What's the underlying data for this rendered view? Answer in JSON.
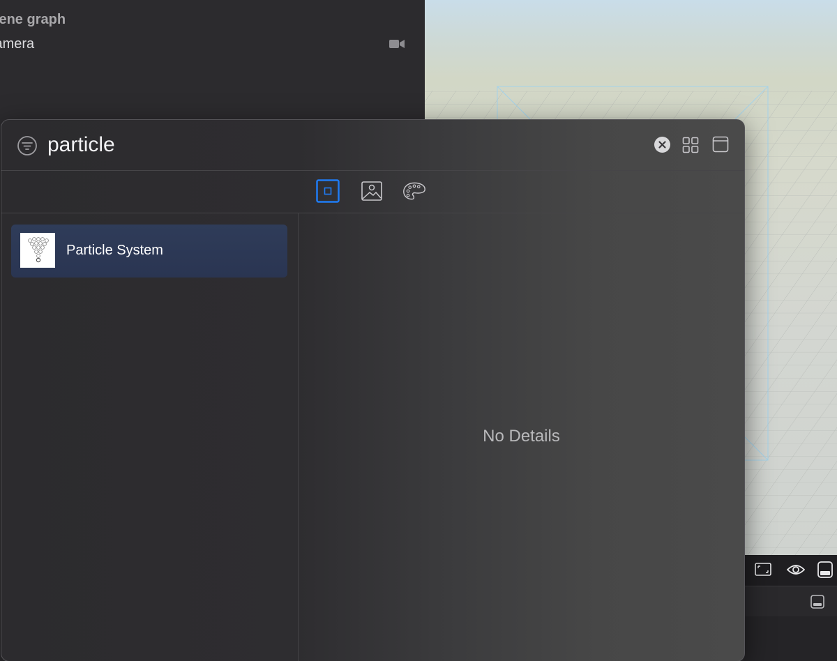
{
  "scene_graph": {
    "title": "Scene graph",
    "items": [
      {
        "label": "Camera",
        "icon": "camera-icon"
      }
    ]
  },
  "library": {
    "search": {
      "value": "particle",
      "filter_icon": "filter-icon",
      "clear_icon": "clear-icon"
    },
    "view_buttons": [
      "grid-view-icon",
      "window-icon"
    ],
    "tabs": [
      {
        "name": "objects",
        "icon": "square-icon",
        "selected": true
      },
      {
        "name": "media",
        "icon": "image-icon",
        "selected": false
      },
      {
        "name": "materials",
        "icon": "palette-icon",
        "selected": false
      }
    ],
    "results": [
      {
        "label": "Particle System",
        "icon": "particle-system-icon",
        "selected": true
      }
    ],
    "details": {
      "empty_text": "No Details"
    }
  },
  "viewport_toolbar": {
    "icons": [
      "frame-icon",
      "eye-icon",
      "panel-toggle-icon"
    ]
  },
  "colors": {
    "accent": "#1f7cf5",
    "selection": "#2e3a57",
    "panel": "#2c2b2e"
  }
}
